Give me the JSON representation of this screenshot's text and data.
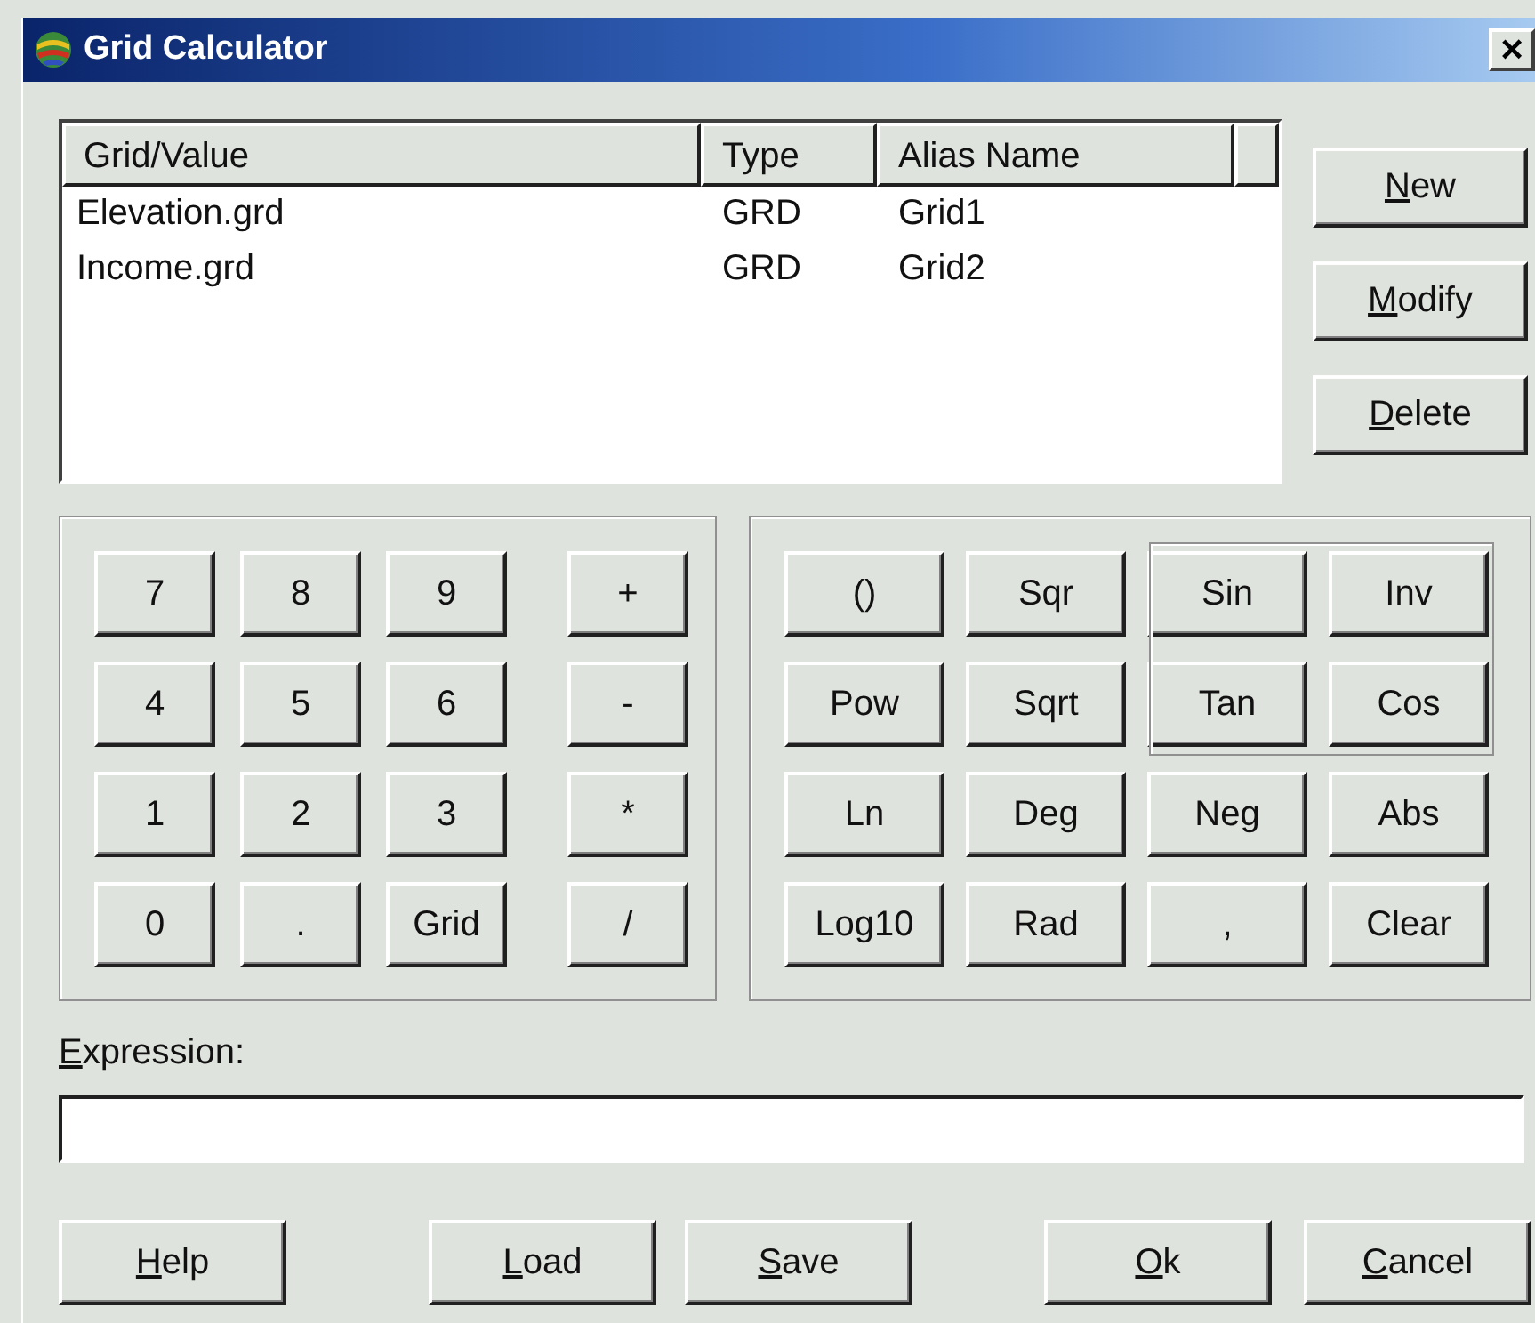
{
  "window": {
    "title": "Grid Calculator",
    "close_label": "×"
  },
  "grid_list": {
    "columns": [
      "Grid/Value",
      "Type",
      "Alias Name"
    ],
    "rows": [
      [
        "Elevation.grd",
        "GRD",
        "Grid1"
      ],
      [
        "Income.grd",
        "GRD",
        "Grid2"
      ]
    ]
  },
  "list_buttons": [
    {
      "label": "New",
      "mnemonic": true
    },
    {
      "label": "Modify",
      "mnemonic": true
    },
    {
      "label": "Delete",
      "mnemonic": true
    }
  ],
  "number_keys": [
    [
      {
        "label": "7",
        "kind": "digit"
      },
      {
        "label": "8",
        "kind": "digit"
      },
      {
        "label": "9",
        "kind": "digit"
      },
      {
        "label": "+",
        "kind": "operator"
      }
    ],
    [
      {
        "label": "4",
        "kind": "digit"
      },
      {
        "label": "5",
        "kind": "digit"
      },
      {
        "label": "6",
        "kind": "digit"
      },
      {
        "label": "-",
        "kind": "operator"
      }
    ],
    [
      {
        "label": "1",
        "kind": "digit"
      },
      {
        "label": "2",
        "kind": "digit"
      },
      {
        "label": "3",
        "kind": "digit"
      },
      {
        "label": "*",
        "kind": "operator"
      }
    ],
    [
      {
        "label": "0",
        "kind": "digit"
      },
      {
        "label": ".",
        "kind": "digit"
      },
      {
        "label": "Grid",
        "kind": "digit"
      },
      {
        "label": "/",
        "kind": "operator"
      }
    ]
  ],
  "function_keys": [
    [
      "()",
      "Sqr",
      "Sin",
      "Inv"
    ],
    [
      "Pow",
      "Sqrt",
      "Tan",
      "Cos"
    ],
    [
      "Ln",
      "Deg",
      "Neg",
      "Abs"
    ],
    [
      "Log10",
      "Rad",
      ",",
      "Clear"
    ]
  ],
  "expression": {
    "label": "Expression:",
    "mnemonic": true
  },
  "bottom_buttons": [
    {
      "label": "Help",
      "mnemonic": true
    },
    {
      "label": "Load",
      "mnemonic": true
    },
    {
      "label": "Save",
      "mnemonic": true
    },
    {
      "label": "Ok",
      "mnemonic": true
    },
    {
      "label": "Cancel",
      "mnemonic": true
    }
  ]
}
